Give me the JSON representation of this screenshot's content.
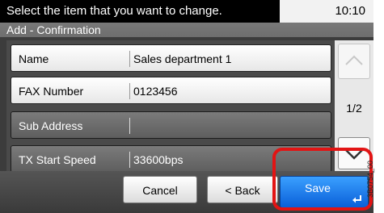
{
  "status": {
    "message": "Select the item that you want to change.",
    "time": "10:10"
  },
  "screen": {
    "title": "Add - Confirmation"
  },
  "rows": [
    {
      "label": "Name",
      "value": "Sales department 1",
      "style": "light"
    },
    {
      "label": "FAX Number",
      "value": "0123456",
      "style": "light"
    },
    {
      "label": "Sub Address",
      "value": "",
      "style": "dark"
    },
    {
      "label": "TX Start Speed",
      "value": "33600bps",
      "style": "dark"
    }
  ],
  "scroll": {
    "page": "1/2",
    "up_icon": "chevron-up-icon",
    "down_icon": "chevron-down-icon"
  },
  "footer": {
    "cancel_label": "Cancel",
    "back_label": "< Back",
    "save_label": "Save"
  },
  "figure_code": "3B0754_00",
  "colors": {
    "save": "#1a73e8",
    "highlight": "#e21414"
  }
}
